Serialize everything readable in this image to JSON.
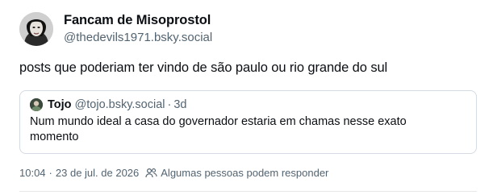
{
  "author": {
    "display_name": "Fancam de Misoprostol",
    "handle": "@thedevils1971.bsky.social"
  },
  "post": {
    "text": "posts que poderiam ter vindo de são paulo ou rio grande do sul"
  },
  "quote": {
    "author_name": "Tojo",
    "author_handle": "@tojo.bsky.social",
    "separator": "·",
    "time": "3d",
    "text": "Num mundo ideal a casa do governador estaria em chamas nesse exato momento"
  },
  "meta": {
    "time": "10:04",
    "separator": "·",
    "date": "23 de jul. de 2026",
    "reply_setting": "Algumas pessoas podem responder",
    "reply_icon": "people-icon"
  },
  "colors": {
    "text": "#0b0f14",
    "muted": "#536471",
    "border": "#d4dbe2"
  }
}
